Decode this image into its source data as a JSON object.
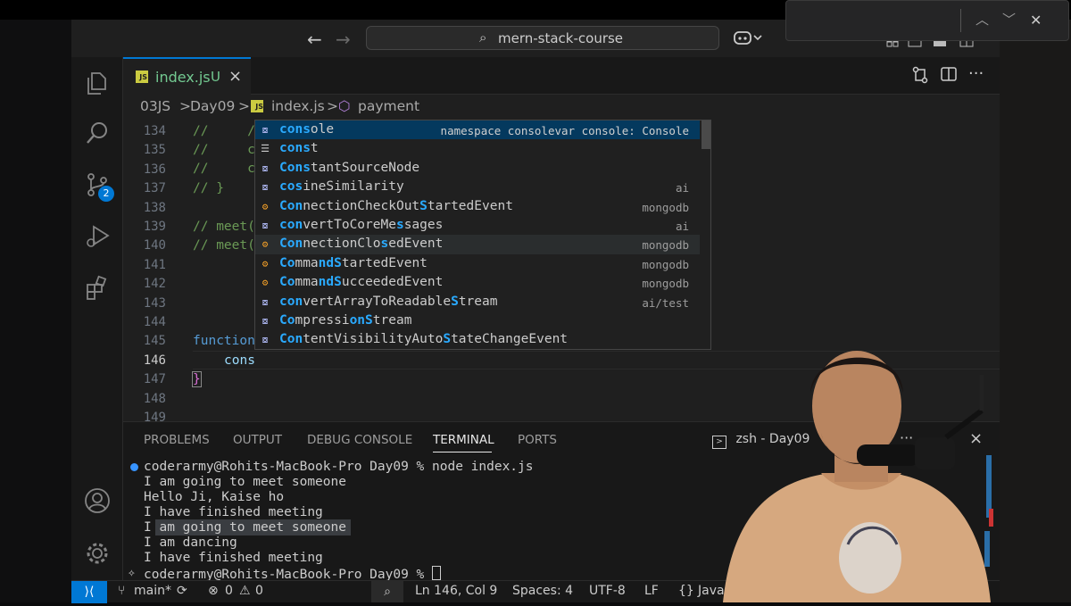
{
  "titlebar": {
    "search_text": "mern-stack-course",
    "back_icon": "arrow-left-icon",
    "forward_icon": "arrow-right-icon",
    "copilot_icon": "copilot-icon"
  },
  "notification": {
    "up_icon": "chevron-up-icon",
    "down_icon": "chevron-down-icon",
    "close_icon": "close-icon"
  },
  "activity_bar": {
    "source_control_badge": "2",
    "items": [
      "explorer-icon",
      "search-icon",
      "source-control-icon",
      "run-debug-icon",
      "extensions-icon",
      "accounts-icon",
      "manage-gear-icon"
    ]
  },
  "tab": {
    "icon_text": "JS",
    "filename": "index.js",
    "status": "U",
    "close": "×"
  },
  "breadcrumb": {
    "items": [
      "03JS",
      "Day09",
      "index.js",
      "payment"
    ],
    "separator": ">"
  },
  "editor": {
    "line_numbers": [
      "134",
      "135",
      "136",
      "137",
      "138",
      "139",
      "140",
      "141",
      "142",
      "143",
      "144",
      "145",
      "146",
      "147",
      "148",
      "149"
    ],
    "current_line": "146",
    "lines": {
      "l134": "//     /",
      "l135": "//     c",
      "l136": "//     c",
      "l137": "// }",
      "l139": "// meet(",
      "l140": "// meet(",
      "l145": "function",
      "l146": "cons",
      "l147": "}"
    }
  },
  "suggest": {
    "items": [
      {
        "pre": "",
        "hl1": "cons",
        "mid": "",
        "hl2": "",
        "post": "ole",
        "detail": "namespace consolevar console: Console",
        "icon": "symbol-variable-icon"
      },
      {
        "pre": "",
        "hl1": "cons",
        "mid": "",
        "hl2": "",
        "post": "t",
        "detail": "",
        "icon": "symbol-keyword-icon"
      },
      {
        "pre": "",
        "hl1": "Cons",
        "mid": "",
        "hl2": "",
        "post": "tantSourceNode",
        "detail": "",
        "icon": "symbol-variable-icon"
      },
      {
        "pre": "",
        "hl1": "co",
        "mid": "",
        "hl2": "s",
        "post": "ineSimilarity",
        "detail": "ai",
        "icon": "symbol-variable-icon"
      },
      {
        "pre": "",
        "hl1": "Con",
        "mid": "nectionCheckOut",
        "hl2": "S",
        "post": "tartedEvent",
        "detail": "mongodb",
        "icon": "symbol-class-icon"
      },
      {
        "pre": "",
        "hl1": "con",
        "mid": "vertToCoreMe",
        "hl2": "s",
        "post": "sages",
        "detail": "ai",
        "icon": "symbol-variable-icon"
      },
      {
        "pre": "",
        "hl1": "Con",
        "mid": "nectionClo",
        "hl2": "s",
        "post": "edEvent",
        "detail": "mongodb",
        "icon": "symbol-class-icon"
      },
      {
        "pre": "",
        "hl1": "Co",
        "mid": "mma",
        "hl2": "nd",
        "post": "",
        "extra_hl": "S",
        "extra_post": "tartedEvent",
        "detail": "mongodb",
        "icon": "symbol-class-icon"
      },
      {
        "pre": "",
        "hl1": "Co",
        "mid": "mma",
        "hl2": "nd",
        "post": "",
        "extra_hl": "S",
        "extra_post": "ucceededEvent",
        "detail": "mongodb",
        "icon": "symbol-class-icon"
      },
      {
        "pre": "",
        "hl1": "con",
        "mid": "vertArrayToReadable",
        "hl2": "S",
        "post": "tream",
        "detail": "ai/test",
        "icon": "symbol-variable-icon"
      },
      {
        "pre": "",
        "hl1": "Co",
        "mid": "mpressi",
        "hl2": "onS",
        "post": "tream",
        "detail": "",
        "icon": "symbol-variable-icon"
      },
      {
        "pre": "",
        "hl1": "Con",
        "mid": "tentVisibilityAuto",
        "hl2": "S",
        "post": "tateChangeEvent",
        "detail": "",
        "icon": "symbol-variable-icon"
      }
    ]
  },
  "panel": {
    "tabs": [
      "PROBLEMS",
      "OUTPUT",
      "DEBUG CONSOLE",
      "TERMINAL",
      "PORTS"
    ],
    "active_tab": "TERMINAL",
    "terminal_name": "zsh - Day09",
    "more": "···",
    "close": "×",
    "terminal_lines": [
      "coderarmy@Rohits-MacBook-Pro Day09 % node index.js",
      "I am going to meet someone",
      "Hello Ji, Kaise ho",
      "I have finished meeting",
      "I am going to meet someone",
      "I am dancing",
      "I have finished meeting",
      "coderarmy@Rohits-MacBook-Pro Day09 % "
    ]
  },
  "statusbar": {
    "branch": "main*",
    "errors": "0",
    "warnings": "0",
    "position": "Ln 146, Col 9",
    "spaces": "Spaces: 4",
    "encoding": "UTF-8",
    "eol": "LF",
    "language": "JavaS"
  }
}
